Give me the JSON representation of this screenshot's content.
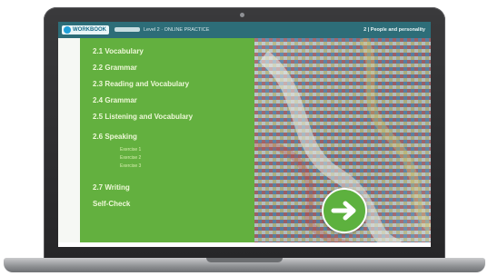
{
  "topbar": {
    "logo": "WORKBOOK",
    "level": "Level 2 · ONLINE PRACTICE",
    "unit": "2 | People and personality"
  },
  "sections": [
    {
      "label": "2.1  Vocabulary"
    },
    {
      "label": "2.2  Grammar"
    },
    {
      "label": "2.3  Reading and Vocabulary"
    },
    {
      "label": "2.4  Grammar"
    },
    {
      "label": "2.5  Listening and Vocabulary"
    },
    {
      "label": "2.6  Speaking"
    },
    {
      "label": "2.7  Writing"
    },
    {
      "label": "Self-Check"
    }
  ],
  "speaking_exercises": [
    "Exercise 1",
    "Exercise 2",
    "Exercise 3"
  ],
  "next_button": {
    "icon": "arrow-right-icon"
  }
}
